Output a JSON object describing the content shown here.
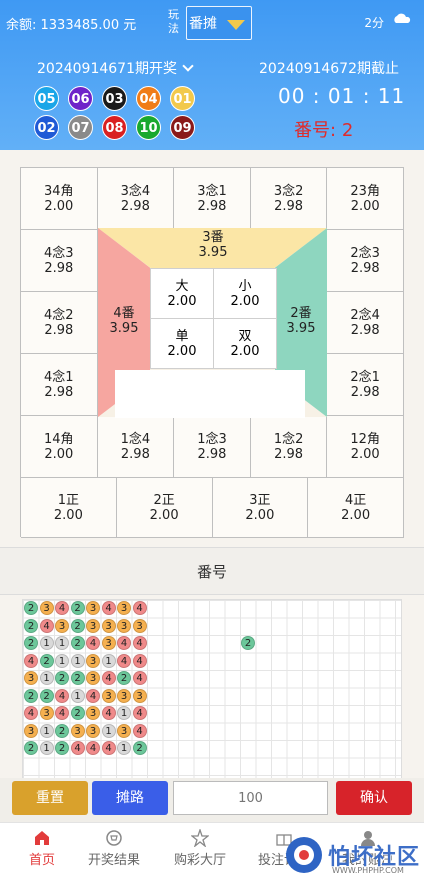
{
  "header": {
    "balance": "余额: 1333485.00 元",
    "mode_label": "玩法",
    "mode_value": "番摊",
    "timer_unit": "2分",
    "current_issue": "20240914671期开奖",
    "next_issue": "20240914672期截止",
    "countdown": "00 : 01 : 11",
    "fan_label": "番号:",
    "fan_value": "2",
    "balls_row1": [
      "05",
      "06",
      "03",
      "04",
      "01"
    ],
    "balls_row2": [
      "02",
      "07",
      "08",
      "10",
      "09"
    ],
    "ball_colors_row1": [
      "#1aa6e8",
      "#6e22c9",
      "#1a1a1a",
      "#f07c17",
      "#f2c94c"
    ],
    "ball_colors_row2": [
      "#1f5ad6",
      "#8a8a8a",
      "#d92020",
      "#19a82e",
      "#8a1a1a"
    ]
  },
  "board": {
    "top_row": [
      {
        "name": "34角",
        "odds": "2.00"
      },
      {
        "name": "3念4",
        "odds": "2.98"
      },
      {
        "name": "3念1",
        "odds": "2.98"
      },
      {
        "name": "3念2",
        "odds": "2.98"
      },
      {
        "name": "23角",
        "odds": "2.00"
      }
    ],
    "left_col": [
      {
        "name": "4念3",
        "odds": "2.98"
      },
      {
        "name": "4念2",
        "odds": "2.98"
      },
      {
        "name": "4念1",
        "odds": "2.98"
      }
    ],
    "right_col": [
      {
        "name": "2念3",
        "odds": "2.98"
      },
      {
        "name": "2念4",
        "odds": "2.98"
      },
      {
        "name": "2念1",
        "odds": "2.98"
      }
    ],
    "bottom_row": [
      {
        "name": "14角",
        "odds": "2.00"
      },
      {
        "name": "1念4",
        "odds": "2.98"
      },
      {
        "name": "1念3",
        "odds": "2.98"
      },
      {
        "name": "1念2",
        "odds": "2.98"
      },
      {
        "name": "12角",
        "odds": "2.00"
      }
    ],
    "zheng_row": [
      {
        "name": "1正",
        "odds": "2.00"
      },
      {
        "name": "2正",
        "odds": "2.00"
      },
      {
        "name": "3正",
        "odds": "2.00"
      },
      {
        "name": "4正",
        "odds": "2.00"
      }
    ],
    "fan3": {
      "name": "3番",
      "odds": "3.95"
    },
    "fan4": {
      "name": "4番",
      "odds": "3.95"
    },
    "fan2": {
      "name": "2番",
      "odds": "3.95"
    },
    "inner": [
      {
        "name": "大",
        "odds": "2.00"
      },
      {
        "name": "小",
        "odds": "2.00"
      },
      {
        "name": "单",
        "odds": "2.00"
      },
      {
        "name": "双",
        "odds": "2.00"
      }
    ]
  },
  "section_title": "番号",
  "trend": {
    "rows": [
      [
        2,
        3,
        4,
        2,
        3,
        4,
        3,
        4
      ],
      [
        2,
        4,
        3,
        2,
        3,
        3,
        3,
        3
      ],
      [
        2,
        1,
        1,
        2,
        4,
        3,
        4,
        4
      ],
      [
        4,
        2,
        1,
        1,
        3,
        1,
        4,
        4
      ],
      [
        3,
        1,
        2,
        2,
        3,
        4,
        2,
        4
      ],
      [
        2,
        2,
        4,
        1,
        4,
        3,
        3,
        3
      ],
      [
        4,
        3,
        4,
        2,
        3,
        4,
        1,
        4
      ],
      [
        3,
        1,
        2,
        3,
        3,
        1,
        3,
        4
      ],
      [
        2,
        1,
        2,
        4,
        4,
        4,
        1,
        2
      ]
    ],
    "extra": 2,
    "colors": {
      "1": "#d9d9d9",
      "2": "#6cc79a",
      "3": "#f5b04f",
      "4": "#f08a8a"
    }
  },
  "actions": {
    "reset": "重置",
    "trend_road": "摊路",
    "amount_placeholder": "100",
    "confirm": "确认"
  },
  "tabs": [
    {
      "label": "首页",
      "icon": "home-icon"
    },
    {
      "label": "开奖结果",
      "icon": "trophy-icon"
    },
    {
      "label": "购彩大厅",
      "icon": "star-icon"
    },
    {
      "label": "投注记录",
      "icon": "gift-icon"
    },
    {
      "label": "我的账户",
      "icon": "user-icon"
    }
  ],
  "watermark": {
    "text": "怕坏社区",
    "sub": "WWW.PHPHP.COM"
  }
}
